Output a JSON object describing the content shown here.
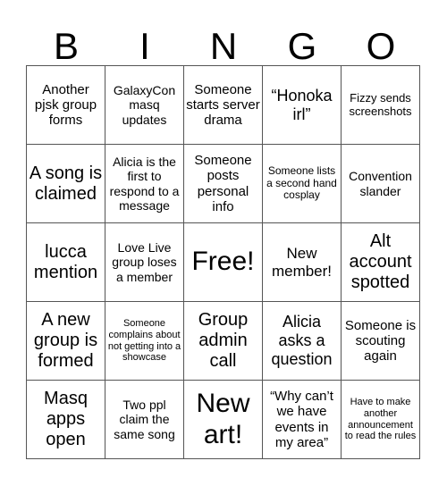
{
  "header": {
    "letters": [
      "B",
      "I",
      "N",
      "G",
      "O"
    ]
  },
  "board": {
    "rows": [
      [
        "Another pjsk group forms",
        "GalaxyCon masq updates",
        "Someone starts server drama",
        "“Honoka irl”",
        "Fizzy sends screenshots"
      ],
      [
        "A song is claimed",
        "Alicia is the first to respond to a message",
        "Someone posts personal info",
        "Someone lists a second hand cosplay",
        "Convention slander"
      ],
      [
        "lucca mention",
        "Love Live group loses a member",
        "Free!",
        "New member!",
        "Alt account spotted"
      ],
      [
        "A new group is formed",
        "Someone complains about not getting into a showcase",
        "Group admin call",
        "Alicia asks a question",
        "Someone is scouting again"
      ],
      [
        "Masq apps open",
        "Two ppl claim the same song",
        "New art!",
        "“Why can’t we have events in my area”",
        "Have to make another announcement to read the rules"
      ]
    ]
  }
}
